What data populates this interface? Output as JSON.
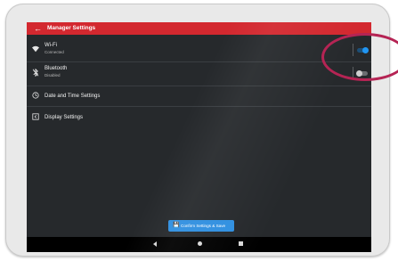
{
  "app_bar": {
    "back_icon": "arrow-left-icon",
    "title": "Manager Settings",
    "color": "#d3282f"
  },
  "settings": {
    "wifi": {
      "icon": "wifi-icon",
      "title": "Wi-Fi",
      "status": "Connected",
      "enabled": true
    },
    "bluetooth": {
      "icon": "bluetooth-disabled-icon",
      "title": "Bluetooth",
      "status": "Disabled",
      "enabled": false
    },
    "date_time": {
      "icon": "clock-icon",
      "title": "Date and Time Settings"
    },
    "display": {
      "icon": "display-icon",
      "title": "Display Settings"
    }
  },
  "save_button": {
    "icon": "save-icon",
    "label": "Confirm Settings & Save",
    "color": "#2f8fe0"
  },
  "nav_bar": {
    "back": "back-triangle-icon",
    "home": "home-circle-icon",
    "recent": "recent-square-icon"
  },
  "annotation": {
    "shape": "ellipse",
    "color": "#b52454"
  }
}
